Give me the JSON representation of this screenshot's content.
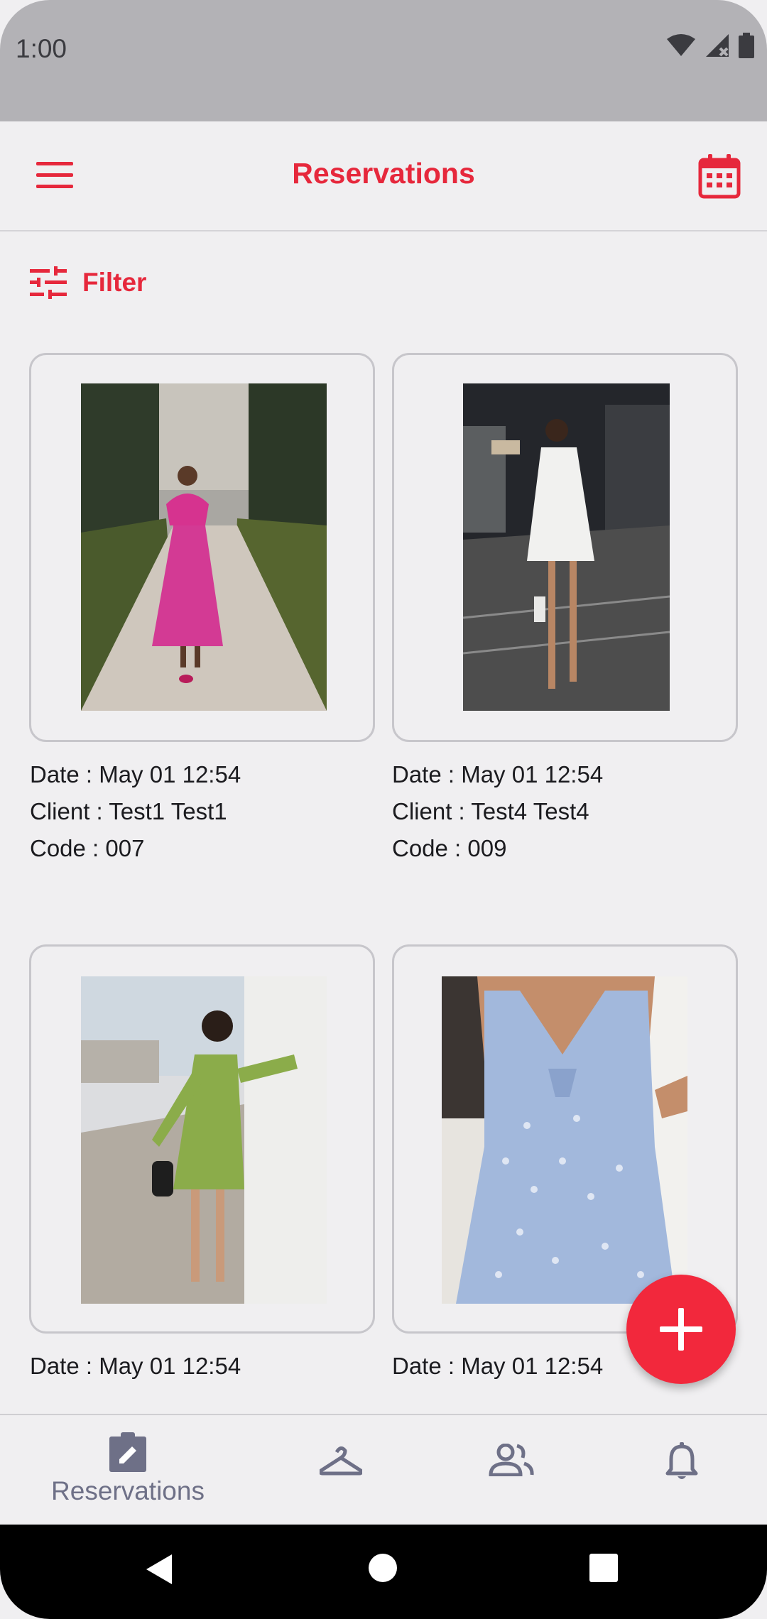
{
  "status_bar": {
    "time": "1:00"
  },
  "app_bar": {
    "title": "Reservations"
  },
  "filter": {
    "label": "Filter"
  },
  "reservations": [
    {
      "date": "Date : May 01 12:54",
      "client": "Client : Test1 Test1",
      "code": "Code : 007"
    },
    {
      "date": "Date : May 01 12:54",
      "client": "Client : Test4 Test4",
      "code": "Code : 009"
    },
    {
      "date": "Date : May 01 12:54"
    },
    {
      "date": "Date : May 01 12:54"
    }
  ],
  "bottom_nav": {
    "items": [
      {
        "label": "Reservations",
        "icon": "clipboard-edit-icon",
        "active": true
      },
      {
        "icon": "hanger-icon"
      },
      {
        "icon": "people-icon"
      },
      {
        "icon": "bell-icon"
      }
    ]
  },
  "colors": {
    "accent": "#e6283c",
    "fab": "#f2283c",
    "nav_inactive": "#6e7087"
  }
}
